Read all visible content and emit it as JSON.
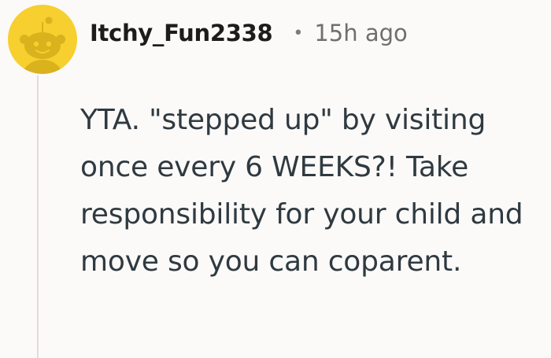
{
  "comment": {
    "author": "Itchy_Fun2338",
    "separator": "•",
    "timestamp": "15h ago",
    "body": "YTA. \"stepped up\" by visiting once every 6 WEEKS?! Take responsibility for your child and move so you can coparent."
  },
  "avatar": {
    "icon": "snoo-avatar-icon",
    "background_color": "#f7cf2e"
  },
  "colors": {
    "thread_line": "#e4dcd5",
    "text": "#2f3a40",
    "username": "#1c1c1c",
    "meta": "#6f6f6f"
  }
}
